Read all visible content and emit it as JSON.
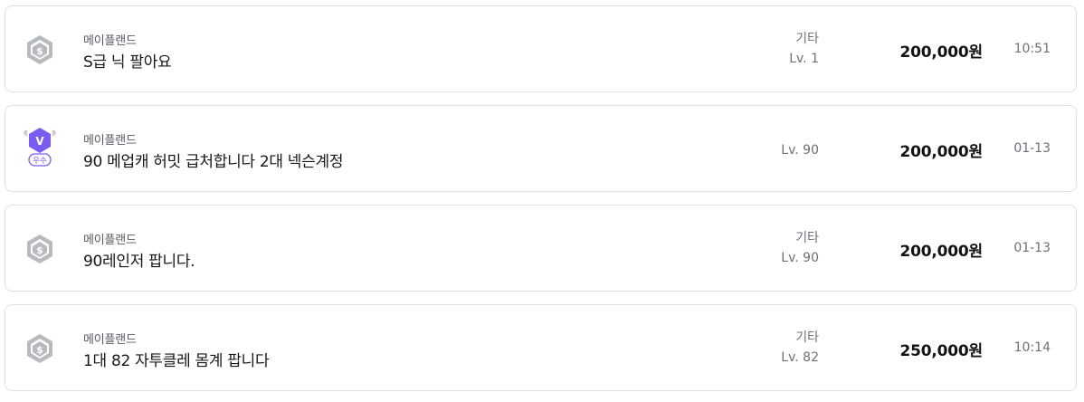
{
  "listings": [
    {
      "badge": "shield-dollar-icon",
      "seller": "메이플랜드",
      "title": "S급 닉 팔아요",
      "category": "기타",
      "level": "Lv. 1",
      "price": "200,000원",
      "time": "10:51"
    },
    {
      "badge": "v-grade-excellent-icon",
      "badge_label": "우수",
      "seller": "메이플랜드",
      "title": "90 메업캐 허밋 급처합니다 2대 넥슨계정",
      "category": "",
      "level": "Lv. 90",
      "price": "200,000원",
      "time": "01-13"
    },
    {
      "badge": "shield-dollar-icon",
      "seller": "메이플랜드",
      "title": "90레인저 팝니다.",
      "category": "기타",
      "level": "Lv. 90",
      "price": "200,000원",
      "time": "01-13"
    },
    {
      "badge": "shield-dollar-icon",
      "seller": "메이플랜드",
      "title": "1대 82 자투클레 몸계 팝니다",
      "category": "기타",
      "level": "Lv. 82",
      "price": "250,000원",
      "time": "10:14"
    }
  ],
  "colors": {
    "badge_gray": "#b7babf",
    "badge_purple": "#7a5cf0",
    "border": "#dcdfe4"
  }
}
